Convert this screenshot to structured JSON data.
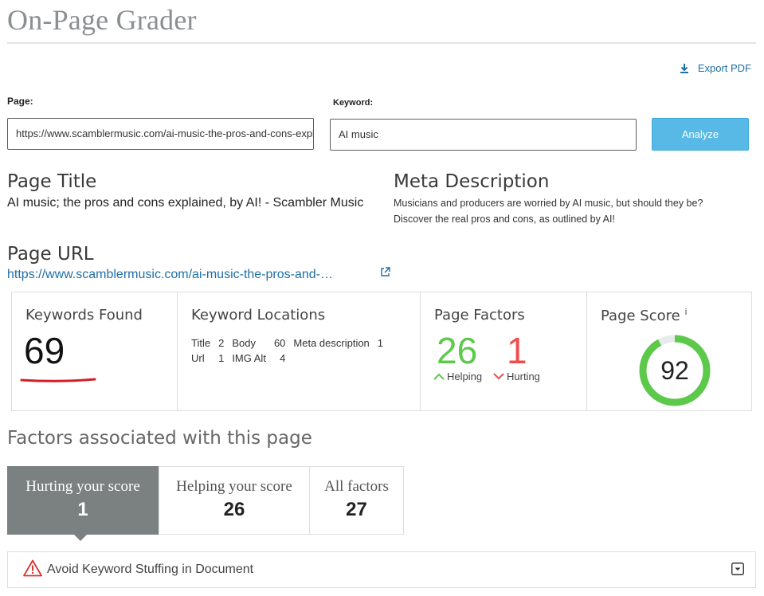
{
  "header": {
    "title": "On-Page Grader",
    "export_label": "Export PDF"
  },
  "form": {
    "page_label": "Page:",
    "page_value": "https://www.scamblermusic.com/ai-music-the-pros-and-cons-explained-by-ai/",
    "keyword_label": "Keyword:",
    "keyword_value": "AI music",
    "analyze_label": "Analyze"
  },
  "summary": {
    "page_title_heading": "Page Title",
    "page_title_text": "AI music; the pros and cons explained, by AI! - Scambler Music",
    "meta_heading": "Meta Description",
    "meta_text": "Musicians and producers are worried by AI music, but should they be? Discover the real pros and cons, as outlined by AI!",
    "url_heading": "Page URL",
    "url_text": "https://www.scamblermusic.com/ai-music-the-pros-and-…"
  },
  "stats": {
    "keywords_found_label": "Keywords Found",
    "keywords_found_value": "69",
    "locations_label": "Keyword Locations",
    "locations": [
      {
        "name": "Title",
        "value": "2"
      },
      {
        "name": "Body",
        "value": "60"
      },
      {
        "name": "Meta description",
        "value": "1"
      },
      {
        "name": "Url",
        "value": "1"
      },
      {
        "name": "IMG Alt",
        "value": "4"
      }
    ],
    "factors_label": "Page Factors",
    "helping_value": "26",
    "helping_label": "Helping",
    "hurting_value": "1",
    "hurting_label": "Hurting",
    "score_label": "Page Score",
    "score_info": "i",
    "score_value": "92",
    "score_fraction": 0.92
  },
  "factors": {
    "heading": "Factors associated with this page",
    "tabs": [
      {
        "label": "Hurting your score",
        "count": "1"
      },
      {
        "label": "Helping your score",
        "count": "26"
      },
      {
        "label": "All factors",
        "count": "27"
      }
    ],
    "issues": [
      {
        "label": "Avoid Keyword Stuffing in Document"
      }
    ]
  },
  "colors": {
    "helping": "#5cc94a",
    "hurting": "#ee4e4e",
    "link": "#1f6fa5",
    "button": "#58b9e6",
    "active_tab": "#7b8081",
    "gauge": "#5cc94a",
    "gauge_track": "#e8eaeb"
  }
}
